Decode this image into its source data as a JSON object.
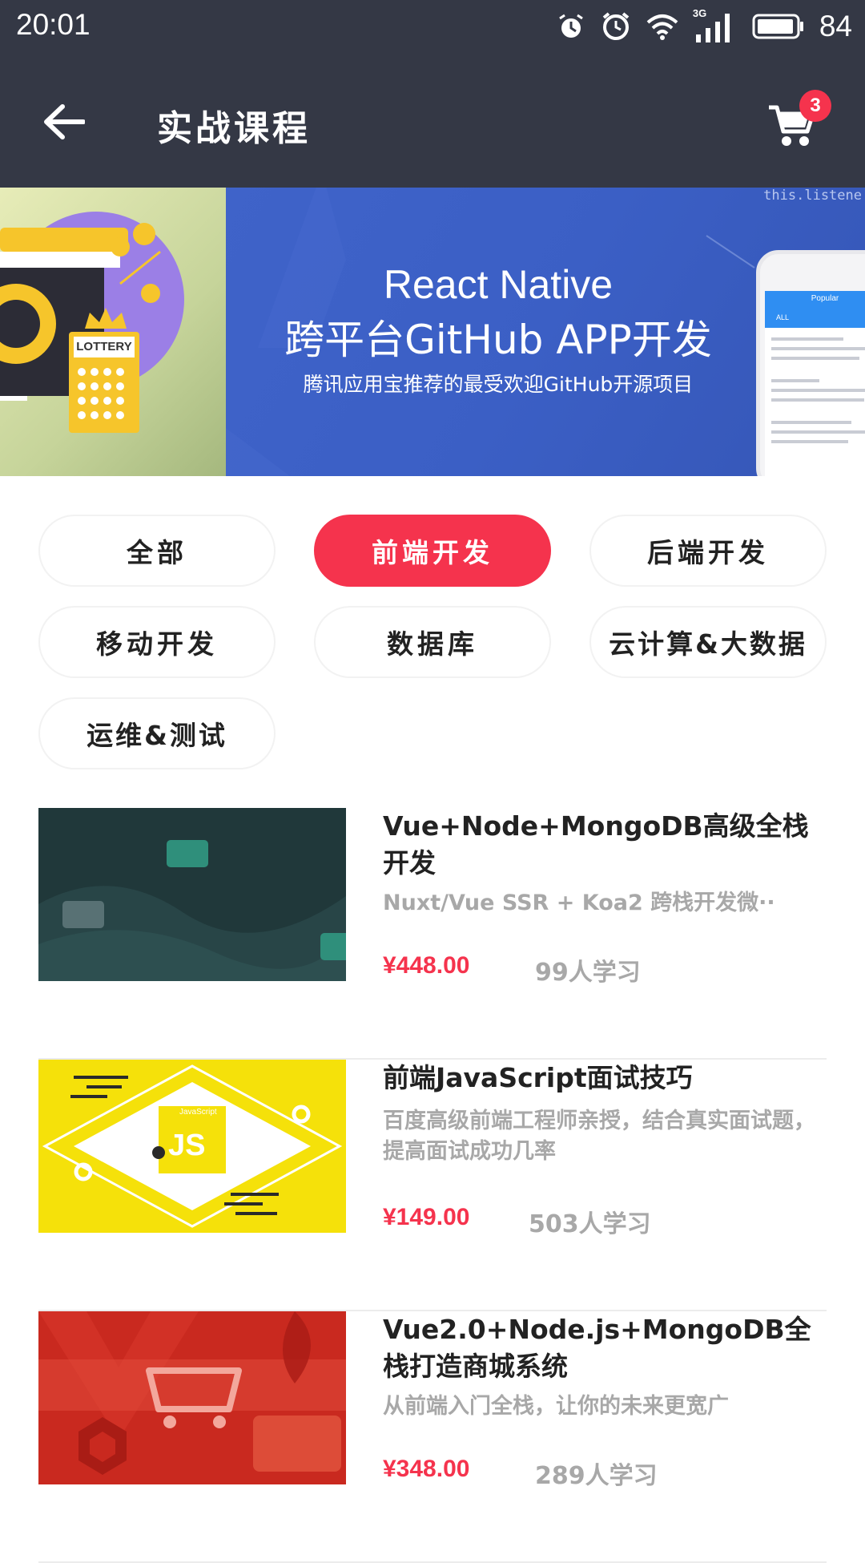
{
  "status_bar": {
    "time": "20:01",
    "network": "3G",
    "battery": "84",
    "icons": [
      "alarm-icon",
      "clock-icon",
      "wifi-icon",
      "signal-icon",
      "battery-icon"
    ]
  },
  "header": {
    "title": "实战课程",
    "cart_badge": "3",
    "icons": [
      "back-arrow-icon",
      "cart-icon"
    ]
  },
  "banner": {
    "left_label": "LOTTERY",
    "title_line1": "React Native",
    "title_line2": "跨平台GitHub APP开发",
    "subtitle": "腾讯应用宝推荐的最受欢迎GitHub开源项目",
    "code_text": "this.listene",
    "phone_header": "Popular",
    "phone_tab": "ALL"
  },
  "categories": [
    {
      "label": "全部",
      "active": false
    },
    {
      "label": "前端开发",
      "active": true
    },
    {
      "label": "后端开发",
      "active": false
    },
    {
      "label": "移动开发",
      "active": false
    },
    {
      "label": "数据库",
      "active": false
    },
    {
      "label": "云计算&大数据",
      "active": false
    },
    {
      "label": "运维&测试",
      "active": false
    }
  ],
  "courses": [
    {
      "title": "Vue+Node+MongoDB高级全栈开发",
      "description": "Nuxt/Vue SSR + Koa2 跨栈开发微··",
      "price": "¥448.00",
      "learners": "99人学习"
    },
    {
      "title": "前端JavaScript面试技巧",
      "description": "百度高级前端工程师亲授，结合真实面试题，提高面试成功几率",
      "price": "¥149.00",
      "learners": "503人学习",
      "thumb_label": "JS",
      "thumb_caption": "JavaScript"
    },
    {
      "title": "Vue2.0+Node.js+MongoDB全栈打造商城系统",
      "description": "从前端入门全栈，让你的未来更宽广",
      "price": "¥348.00",
      "learners": "289人学习"
    }
  ],
  "colors": {
    "header_bg": "#343845",
    "accent": "#f5334d",
    "banner_blue": "#3f63c9",
    "muted_text": "#a8a8a8"
  }
}
